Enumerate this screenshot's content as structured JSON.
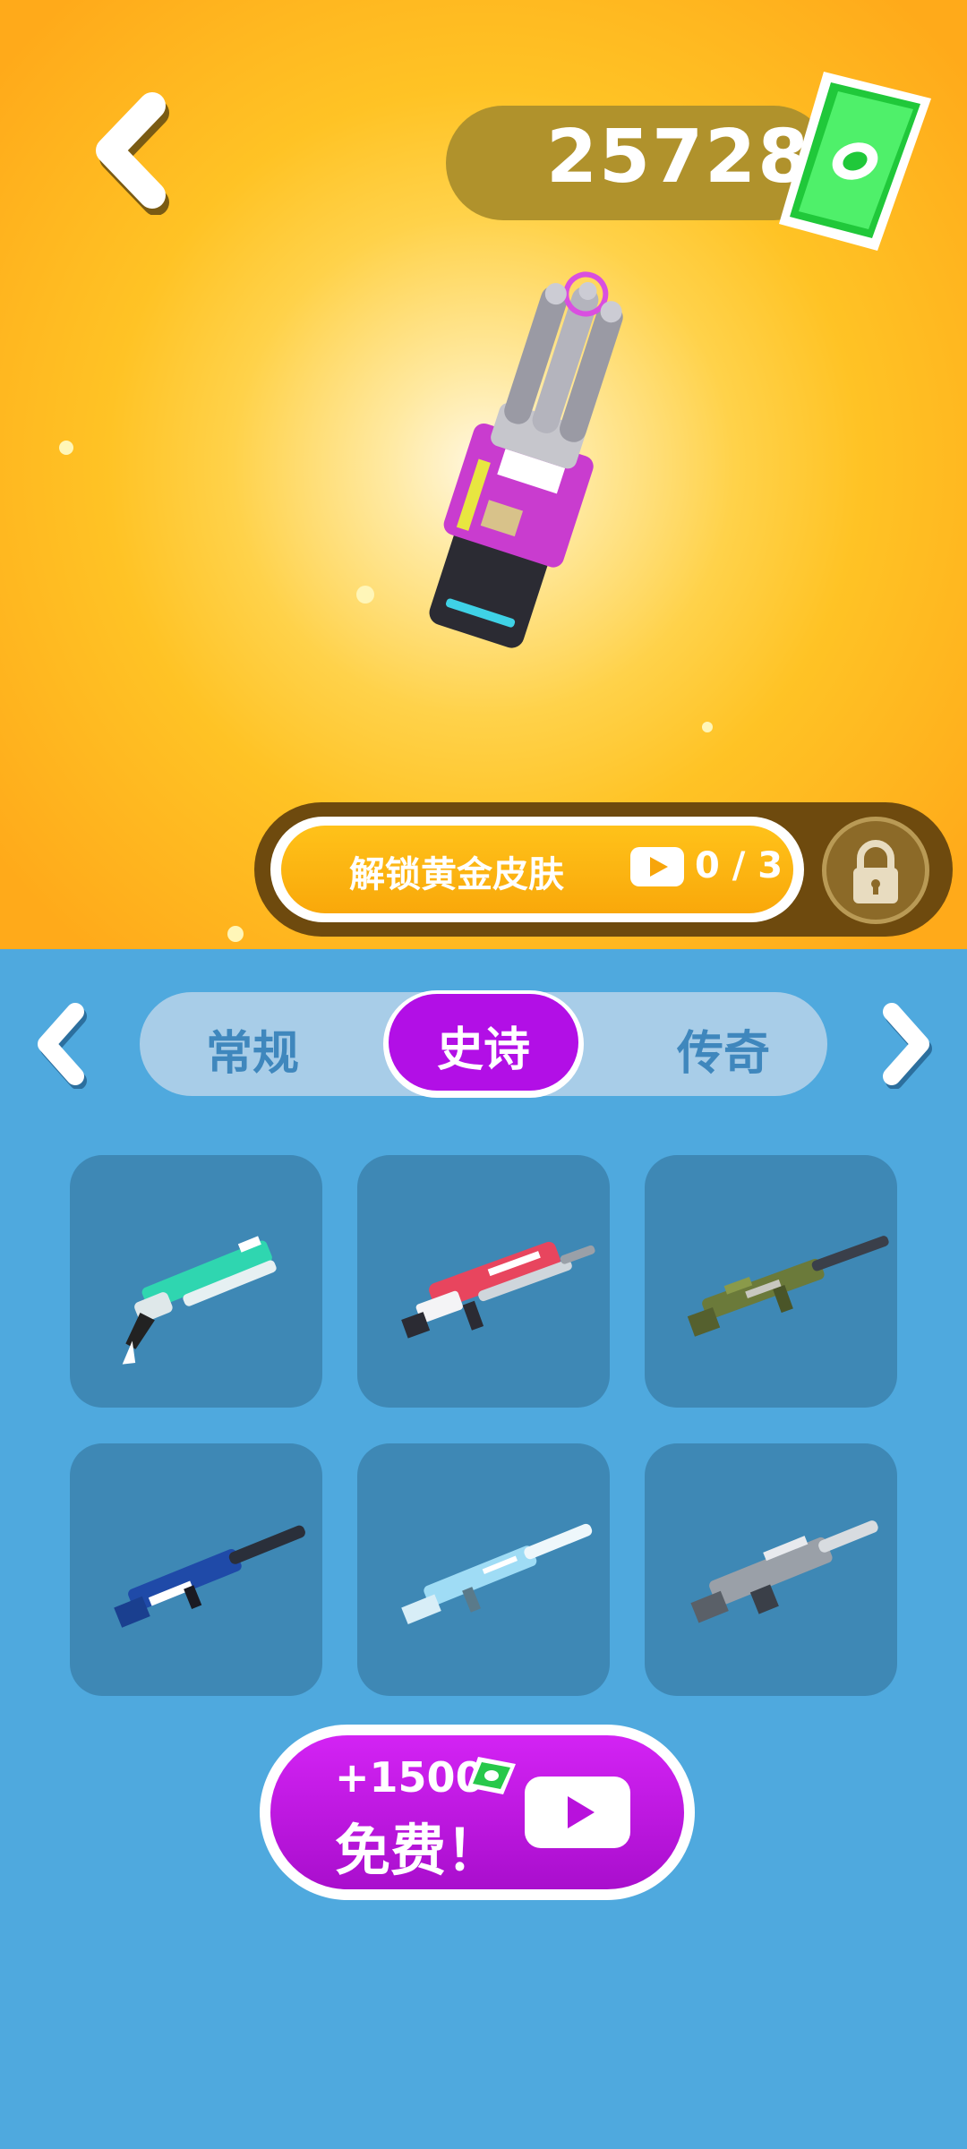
{
  "header": {
    "back_icon": "chevron-left-icon",
    "coins": "25728",
    "coins_icon": "cash-stack-icon"
  },
  "preview": {
    "weapon_icon": "minigun-icon",
    "weapon_color": "#c93ccf"
  },
  "unlock": {
    "label": "解锁黄金皮肤",
    "progress": "0 / 3",
    "video_icon": "video-play-icon",
    "lock_icon": "lock-icon"
  },
  "tabs": {
    "items": [
      {
        "label": "常规"
      },
      {
        "label": "史诗"
      },
      {
        "label": "传奇"
      }
    ],
    "active": "史诗",
    "active_color": "#b20fe6",
    "prev_icon": "chevron-left-icon",
    "next_icon": "chevron-right-icon"
  },
  "weapons": [
    {
      "icon": "shotgun-teal-icon",
      "color": "#2fd6b0"
    },
    {
      "icon": "rifle-red-icon",
      "color": "#e8455e"
    },
    {
      "icon": "sniper-camo-icon",
      "color": "#6b7a3a"
    },
    {
      "icon": "rifle-blue-icon",
      "color": "#1f4aa8"
    },
    {
      "icon": "rifle-lightblue-icon",
      "color": "#9fdcf5"
    },
    {
      "icon": "machinegun-silver-icon",
      "color": "#9aa0a8"
    }
  ],
  "reward": {
    "amount": "+1500",
    "label": "免费！",
    "cash_icon": "cash-icon",
    "video_icon": "video-play-icon",
    "color": "#c21be3"
  }
}
